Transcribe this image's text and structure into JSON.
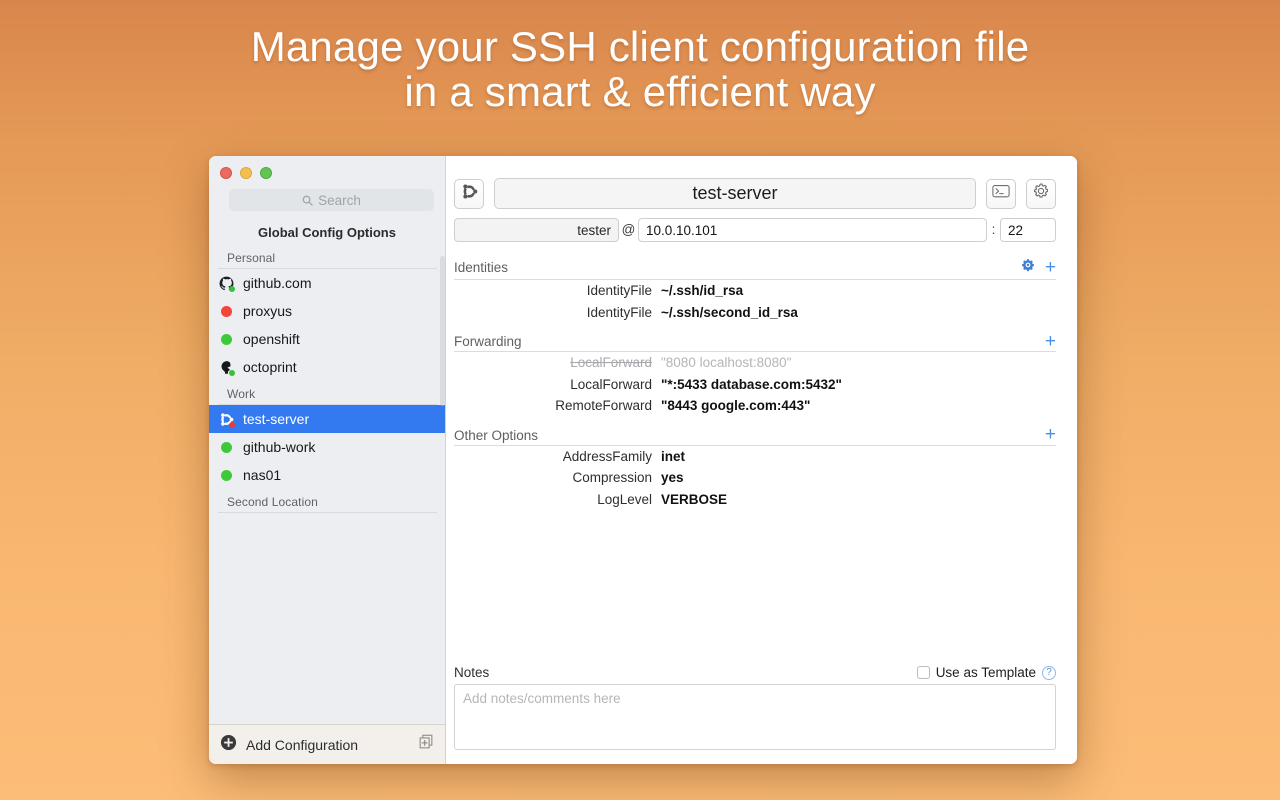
{
  "headline": "Manage your SSH client configuration file\nin a smart & efficient way",
  "sidebar": {
    "search_placeholder": "Search",
    "global_config_label": "Global Config Options",
    "groups": [
      {
        "name": "Personal",
        "items": [
          {
            "label": "github.com",
            "icon": "github-icon",
            "status": "green"
          },
          {
            "label": "proxyus",
            "icon": "circle-icon",
            "status": "red"
          },
          {
            "label": "openshift",
            "icon": "circle-icon",
            "status": "green"
          },
          {
            "label": "octoprint",
            "icon": "octoprint-icon",
            "status": "green"
          }
        ]
      },
      {
        "name": "Work",
        "items": [
          {
            "label": "test-server",
            "icon": "ubuntu-icon",
            "status": "red",
            "selected": true
          },
          {
            "label": "github-work",
            "icon": "circle-icon",
            "status": "green"
          },
          {
            "label": "nas01",
            "icon": "circle-icon",
            "status": "green"
          }
        ]
      },
      {
        "name": "Second Location",
        "items": []
      }
    ],
    "footer": {
      "add_label": "Add Configuration",
      "add_icon": "plus-circle-icon",
      "duplicate_icon": "duplicate-icon"
    }
  },
  "main": {
    "host_icon": "ubuntu-icon",
    "name_value": "test-server",
    "terminal_icon": "terminal-icon",
    "settings_icon": "gear-icon",
    "user_value": "tester",
    "at_symbol": "@",
    "host_value": "10.0.10.101",
    "colon_symbol": ":",
    "port_value": "22",
    "sections": [
      {
        "title": "Identities",
        "has_gear": true,
        "add_icon": "plus-icon",
        "rows": [
          {
            "key": "IdentityFile",
            "value": "~/.ssh/id_rsa",
            "disabled": false
          },
          {
            "key": "IdentityFile",
            "value": "~/.ssh/second_id_rsa",
            "disabled": false
          }
        ]
      },
      {
        "title": "Forwarding",
        "has_gear": false,
        "add_icon": "plus-icon",
        "rows": [
          {
            "key": "LocalForward",
            "value": "\"8080 localhost:8080\"",
            "disabled": true
          },
          {
            "key": "LocalForward",
            "value": "\"*:5433 database.com:5432\"",
            "disabled": false
          },
          {
            "key": "RemoteForward",
            "value": "\"8443 google.com:443\"",
            "disabled": false
          }
        ]
      },
      {
        "title": "Other Options",
        "has_gear": false,
        "add_icon": "plus-icon",
        "rows": [
          {
            "key": "AddressFamily",
            "value": "inet",
            "disabled": false
          },
          {
            "key": "Compression",
            "value": "yes",
            "disabled": false
          },
          {
            "key": "LogLevel",
            "value": "VERBOSE",
            "disabled": false
          }
        ]
      }
    ],
    "notes": {
      "title": "Notes",
      "placeholder": "Add notes/comments here",
      "template_label": "Use as Template",
      "template_checked": false,
      "help_glyph": "?"
    }
  },
  "colors": {
    "accent_blue": "#3379f0",
    "link_blue": "#4a90e2",
    "status_green": "#3ec93c",
    "status_red": "#f0463b"
  }
}
